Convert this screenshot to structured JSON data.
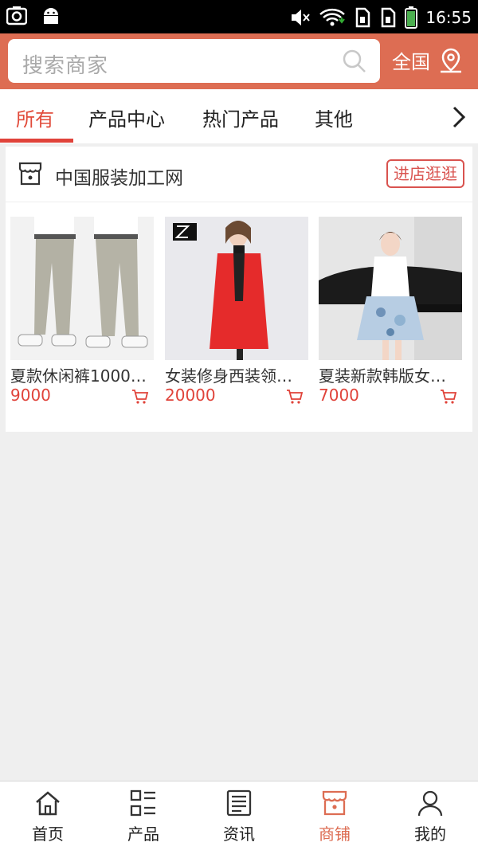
{
  "status_bar": {
    "time": "16:55",
    "icons": [
      "screenshot-icon",
      "android-icon",
      "volume-mute-icon",
      "wifi-icon",
      "sim1-icon",
      "sim2-icon",
      "battery-icon"
    ]
  },
  "search": {
    "placeholder": "搜索商家",
    "region_label": "全国"
  },
  "tabs": [
    {
      "label": "所有",
      "active": true
    },
    {
      "label": "产品中心",
      "active": false
    },
    {
      "label": "热门产品",
      "active": false
    },
    {
      "label": "其他",
      "active": false
    }
  ],
  "store": {
    "name": "中国服装加工网",
    "enter_label": "进店逛逛",
    "products": [
      {
        "title": "夏款休闲裤1000…",
        "price": "9000"
      },
      {
        "title": "女装修身西装领…",
        "price": "20000"
      },
      {
        "title": "夏装新款韩版女…",
        "price": "7000"
      }
    ]
  },
  "bottom_nav": [
    {
      "label": "首页",
      "icon": "home-icon",
      "active": false
    },
    {
      "label": "产品",
      "icon": "product-list-icon",
      "active": false
    },
    {
      "label": "资讯",
      "icon": "news-icon",
      "active": false
    },
    {
      "label": "商铺",
      "icon": "store-icon",
      "active": true
    },
    {
      "label": "我的",
      "icon": "user-icon",
      "active": false
    }
  ],
  "colors": {
    "brand": "#dd6d53",
    "accent_red": "#e0433a",
    "background": "#efefef"
  }
}
